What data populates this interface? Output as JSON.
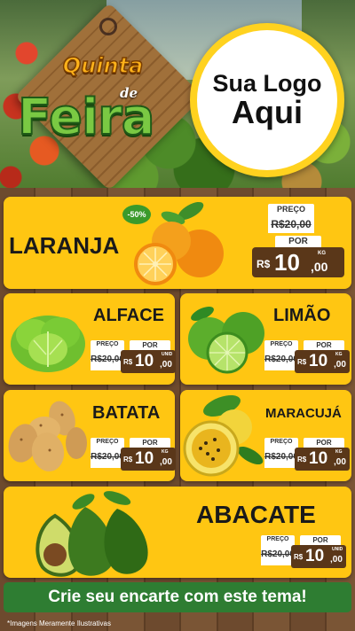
{
  "header": {
    "title_top": "Quinta",
    "title_de": "de",
    "title_main": "Feira",
    "logo_line1": "Sua Logo",
    "logo_line2": "Aqui"
  },
  "featured": {
    "name": "LARANJA",
    "badge": "-50%",
    "label_old": "PREÇO",
    "old_price": "R$20,00",
    "label_new": "POR",
    "currency": "R$",
    "price_int": "10",
    "price_dec": ",00",
    "unit": "KG"
  },
  "products": [
    {
      "name": "ALFACE",
      "label_old": "PREÇO",
      "old_price": "R$20,00",
      "label_new": "POR",
      "currency": "R$",
      "price_int": "10",
      "price_dec": ",00",
      "unit": "UNID"
    },
    {
      "name": "LIMÃO",
      "label_old": "PREÇO",
      "old_price": "R$20,00",
      "label_new": "POR",
      "currency": "R$",
      "price_int": "10",
      "price_dec": ",00",
      "unit": "KG"
    },
    {
      "name": "BATATA",
      "label_old": "PREÇO",
      "old_price": "R$20,00",
      "label_new": "POR",
      "currency": "R$",
      "price_int": "10",
      "price_dec": ",00",
      "unit": "KG"
    },
    {
      "name": "MARACUJÁ",
      "label_old": "PREÇO",
      "old_price": "R$20,00",
      "label_new": "POR",
      "currency": "R$",
      "price_int": "10",
      "price_dec": ",00",
      "unit": "KG"
    },
    {
      "name": "ABACATE",
      "label_old": "PREÇO",
      "old_price": "R$20,00",
      "label_new": "POR",
      "currency": "R$",
      "price_int": "10",
      "price_dec": ",00",
      "unit": "UNID"
    }
  ],
  "cta": "Crie seu encarte com este tema!",
  "disclaimer": "*Imagens Meramente Ilustrativas",
  "colors": {
    "card": "#ffc612",
    "price_bg": "#5a3719",
    "cta_bg": "#2e7d32",
    "logo_ring": "#ffd21f"
  }
}
